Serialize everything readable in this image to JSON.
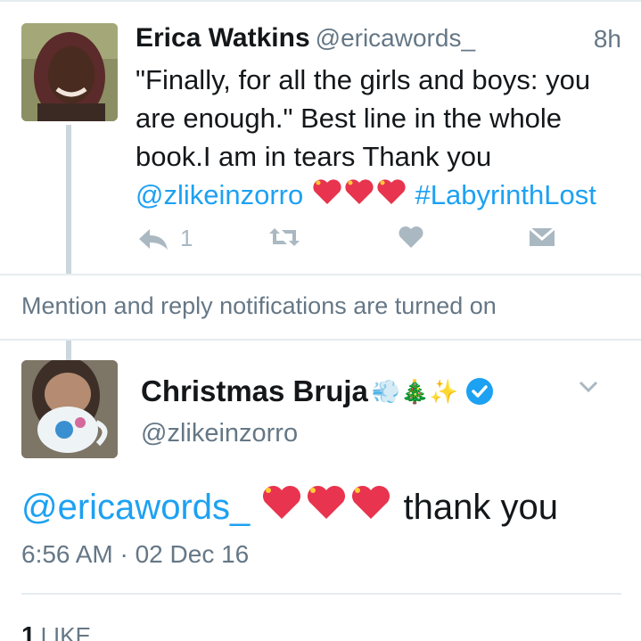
{
  "reply_tweet": {
    "name": "Erica Watkins",
    "handle": "@ericawords_",
    "time": "8h",
    "text_line1": "\"Finally, for all the girls and boys: you",
    "text_line2": "are enough.\" Best line in the whole",
    "text_line3": "book.I am in tears Thank you",
    "mention": "@zlikeinzorro",
    "hashtag": "#LabyrinthLost",
    "reply_count": "1"
  },
  "notice": "Mention and reply notifications are turned on",
  "main_tweet": {
    "name": "Christmas Bruja",
    "name_emoji": "💨🎄✨",
    "handle": "@zlikeinzorro",
    "mention": "@ericawords_",
    "text": "thank you",
    "timestamp": "6:56 AM · 02 Dec 16",
    "like_count": "1",
    "like_label": "LIKE"
  },
  "icons": [
    "reply-icon",
    "retweet-icon",
    "like-heart-icon",
    "direct-message-icon",
    "verified-badge-icon",
    "chevron-down-icon",
    "sparkling-heart-emoji"
  ],
  "colors": {
    "link": "#1da1f2",
    "muted": "#657786",
    "action": "#aab8c2",
    "heart_emoji": "#e8344e"
  }
}
